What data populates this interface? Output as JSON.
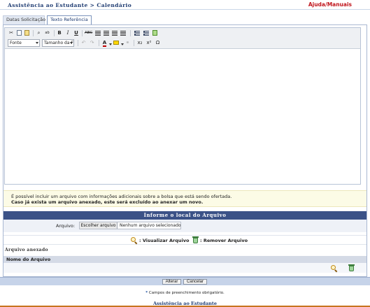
{
  "header": {
    "title": "Assistência ao Estudante > Calendário",
    "help_link": "Ajuda/Manuais"
  },
  "tabs": [
    {
      "label": "Datas Solicitação",
      "active": false
    },
    {
      "label": "Texto Referência",
      "active": true
    }
  ],
  "editor": {
    "font_select": "Fonte",
    "size_select": "Tamanho da F",
    "buttons": {
      "bold": "B",
      "italic": "I",
      "underline": "U",
      "strike": "ABC",
      "font_color": "A",
      "subscript": "x₂",
      "superscript": "x²",
      "special_char": "Ω"
    },
    "font_color": "#c00000",
    "highlight_color": "#ffd700",
    "content": ""
  },
  "notice": {
    "line1": "É possível incluir um arquivo com informações adicionais sobre a bolsa que está sendo ofertada.",
    "line2": "Caso já exista um arquivo anexado, este será excluído ao anexar um novo."
  },
  "file_form": {
    "header": "Informe o local do Arquivo",
    "label": "Arquivo:",
    "button": "Escolher arquivo",
    "status": "Nenhum arquivo selecionado"
  },
  "legend": {
    "view": ": Visualizar Arquivo",
    "remove": ": Remover Arquivo"
  },
  "attached": {
    "title": "Arquivo anexado",
    "column": "Nome do Arquivo"
  },
  "actions": {
    "save": "Alterar",
    "cancel": "Cancelar"
  },
  "required_note": {
    "star": "*",
    "text": " Campos de preenchimento obrigatório."
  },
  "footer": "Assistência ao Estudante",
  "colors": {
    "primary": "#3b5287",
    "title": "#1f3c72",
    "help": "#c0141b",
    "notice_bg": "#fcfbe6",
    "accent_line": "#c7741f"
  }
}
